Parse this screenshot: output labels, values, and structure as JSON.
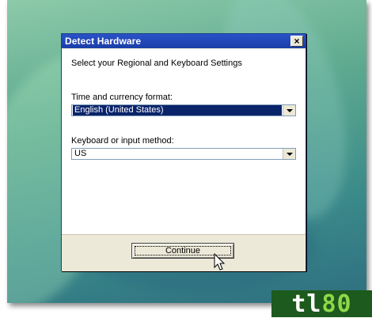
{
  "dialog": {
    "title": "Detect Hardware",
    "close_label": "×",
    "heading": "Select your Regional and Keyboard Settings",
    "time_currency": {
      "label": "Time and currency format:",
      "value": "English (United States)"
    },
    "keyboard": {
      "label": "Keyboard or input method:",
      "value": "US"
    },
    "continue_label": "Continue"
  },
  "watermark": {
    "text_a": "tl",
    "text_b": "80",
    "icon": "logo-watermark"
  }
}
